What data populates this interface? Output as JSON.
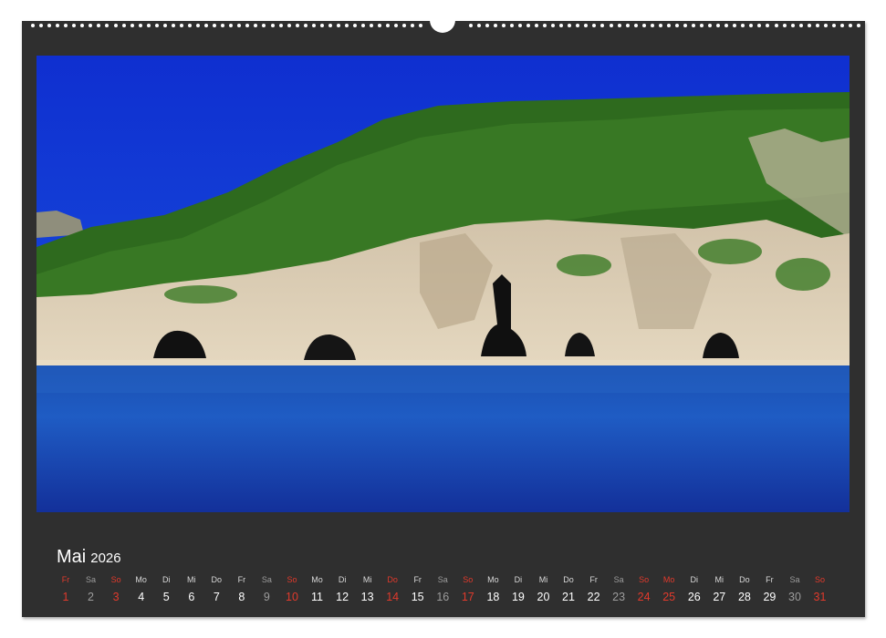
{
  "calendar": {
    "month": "Mai",
    "year": "2026",
    "day_names": [
      "Fr",
      "Sa",
      "So",
      "Mo",
      "Di",
      "Mi",
      "Do",
      "Fr",
      "Sa",
      "So",
      "Mo",
      "Di",
      "Mi",
      "Do",
      "Fr",
      "Sa",
      "So",
      "Mo",
      "Di",
      "Mi",
      "Do",
      "Fr",
      "Sa",
      "So",
      "Mo",
      "Di",
      "Mi",
      "Do",
      "Fr",
      "Sa",
      "So"
    ],
    "days": [
      "1",
      "2",
      "3",
      "4",
      "5",
      "6",
      "7",
      "8",
      "9",
      "10",
      "11",
      "12",
      "13",
      "14",
      "15",
      "16",
      "17",
      "18",
      "19",
      "20",
      "21",
      "22",
      "23",
      "24",
      "25",
      "26",
      "27",
      "28",
      "29",
      "30",
      "31"
    ],
    "highlighted_days": [
      1,
      3,
      10,
      14,
      17,
      24,
      25,
      31
    ],
    "saturdays": [
      2,
      9,
      16,
      23,
      30
    ]
  },
  "photo": {
    "subject": "sea-caves-coastline-photo"
  },
  "colors": {
    "frame": "#2f2f2f",
    "holiday_red": "#e23a2c",
    "text": "#ffffff",
    "muted": "#9c9c9c"
  }
}
